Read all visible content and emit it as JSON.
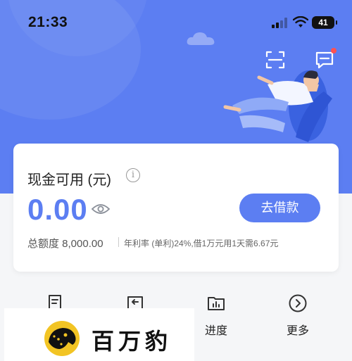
{
  "status_bar": {
    "time": "21:33",
    "battery": "41"
  },
  "card": {
    "title": "现金可用 (元)",
    "amount": "0.00",
    "borrow_button": "去借款",
    "quota": "总额度 8,000.00",
    "rate_info": "年利率 (单利)24%,借1万元用1天需6.67元"
  },
  "menu": {
    "items": [
      {
        "label": "",
        "icon": "document-icon"
      },
      {
        "label": "",
        "icon": "return-icon"
      },
      {
        "label": "进度",
        "icon": "chart-folder-icon"
      },
      {
        "label": "更多",
        "icon": "chevron-right-circle-icon"
      }
    ]
  },
  "brand": {
    "name": "百万豹"
  },
  "colors": {
    "primary": "#5c7ef2",
    "badge": "#ff5252"
  }
}
